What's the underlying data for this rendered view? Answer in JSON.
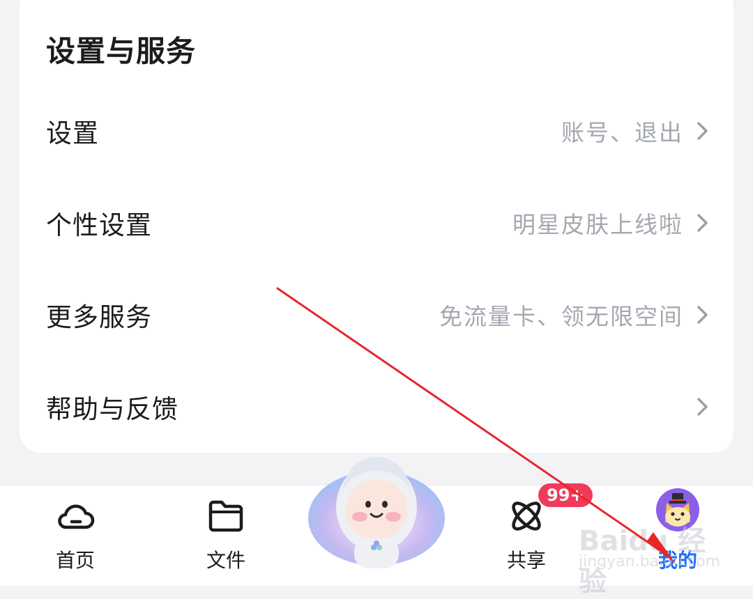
{
  "section": {
    "title": "设置与服务"
  },
  "rows": [
    {
      "label": "设置",
      "hint": "账号、退出"
    },
    {
      "label": "个性设置",
      "hint": "明星皮肤上线啦"
    },
    {
      "label": "更多服务",
      "hint": "免流量卡、领无限空间"
    },
    {
      "label": "帮助与反馈",
      "hint": ""
    }
  ],
  "tabbar": {
    "tabs": [
      {
        "label": "首页",
        "icon": "cloud-icon"
      },
      {
        "label": "文件",
        "icon": "folder-icon"
      },
      {
        "label": "",
        "icon": "mascot-icon"
      },
      {
        "label": "共享",
        "icon": "atom-icon",
        "badge": "99+"
      },
      {
        "label": "我的",
        "icon": "cat-avatar-icon",
        "active": true
      }
    ]
  },
  "watermark": {
    "line1": "Baidu 经验",
    "line2": "jingyan.baidu.com"
  },
  "colors": {
    "accent": "#1a6cff",
    "badge": "#f23a5a",
    "annotation_arrow": "#e8262b"
  }
}
